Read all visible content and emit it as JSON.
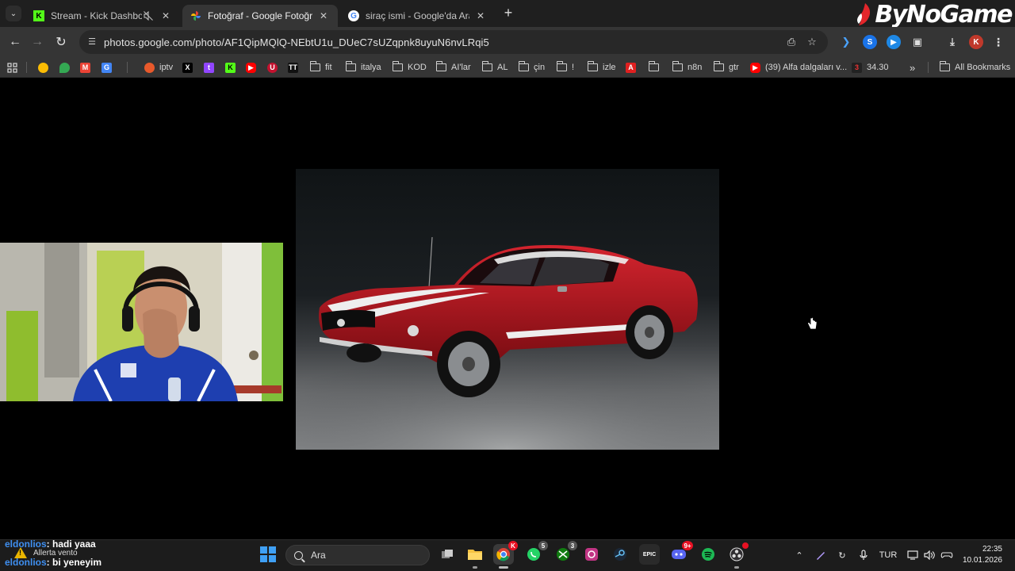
{
  "browser": {
    "tabs": [
      {
        "title": "Stream - Kick Dashboard",
        "muted": true,
        "active": false
      },
      {
        "title": "Fotoğraf - Google Fotoğraflar",
        "active": true
      },
      {
        "title": "siraç ismi - Google'da Ara",
        "active": false
      }
    ],
    "new_tab_label": "+",
    "url": "photos.google.com/photo/AF1QipMQlQ-NEbtU1u_DUeC7sUZqpnk8uyuN6nvLRqi5",
    "profile_initial": "K",
    "watermark": "ByNoGame"
  },
  "bookmarks": {
    "items": [
      {
        "label": "iptv",
        "kind": "site",
        "color": "#e8592b"
      },
      {
        "label": "",
        "kind": "x"
      },
      {
        "label": "",
        "kind": "twitch"
      },
      {
        "label": "",
        "kind": "kick"
      },
      {
        "label": "",
        "kind": "youtube"
      },
      {
        "label": "",
        "kind": "red-u"
      },
      {
        "label": "",
        "kind": "tt"
      },
      {
        "label": "fit",
        "kind": "folder"
      },
      {
        "label": "italya",
        "kind": "folder"
      },
      {
        "label": "KOD",
        "kind": "folder"
      },
      {
        "label": "AI'lar",
        "kind": "folder"
      },
      {
        "label": "AL",
        "kind": "folder"
      },
      {
        "label": "çin",
        "kind": "folder"
      },
      {
        "label": "!",
        "kind": "folder"
      },
      {
        "label": "izle",
        "kind": "folder"
      },
      {
        "label": "",
        "kind": "pdf"
      },
      {
        "label": "",
        "kind": "folder"
      },
      {
        "label": "n8n",
        "kind": "folder"
      },
      {
        "label": "gtr",
        "kind": "folder"
      },
      {
        "label": "(39) Alfa dalgaları v...",
        "kind": "youtube"
      },
      {
        "label": "34.30",
        "kind": "site-dark"
      }
    ],
    "overflow_label": "»",
    "all_bookmarks_label": "All Bookmarks"
  },
  "chat": {
    "messages": [
      {
        "user": "eldonlios",
        "text": ": hadi yaaa"
      },
      {
        "user": "eldonlios",
        "text": ": bi yeneyim"
      }
    ]
  },
  "weather": {
    "label": "Allerta vento"
  },
  "taskbar": {
    "search_placeholder": "Ara",
    "whatsapp_badge": "5",
    "xbox_badge": "3",
    "discord_badge": "9+",
    "chrome_badge": "K",
    "language": "TUR",
    "time": "22:35",
    "date": "10.01.2026"
  },
  "colors": {
    "accent_blue": "#3f8ff0",
    "car_red": "#b81420",
    "tab_active": "#353535",
    "tabstrip_bg": "#1f1f1f"
  }
}
